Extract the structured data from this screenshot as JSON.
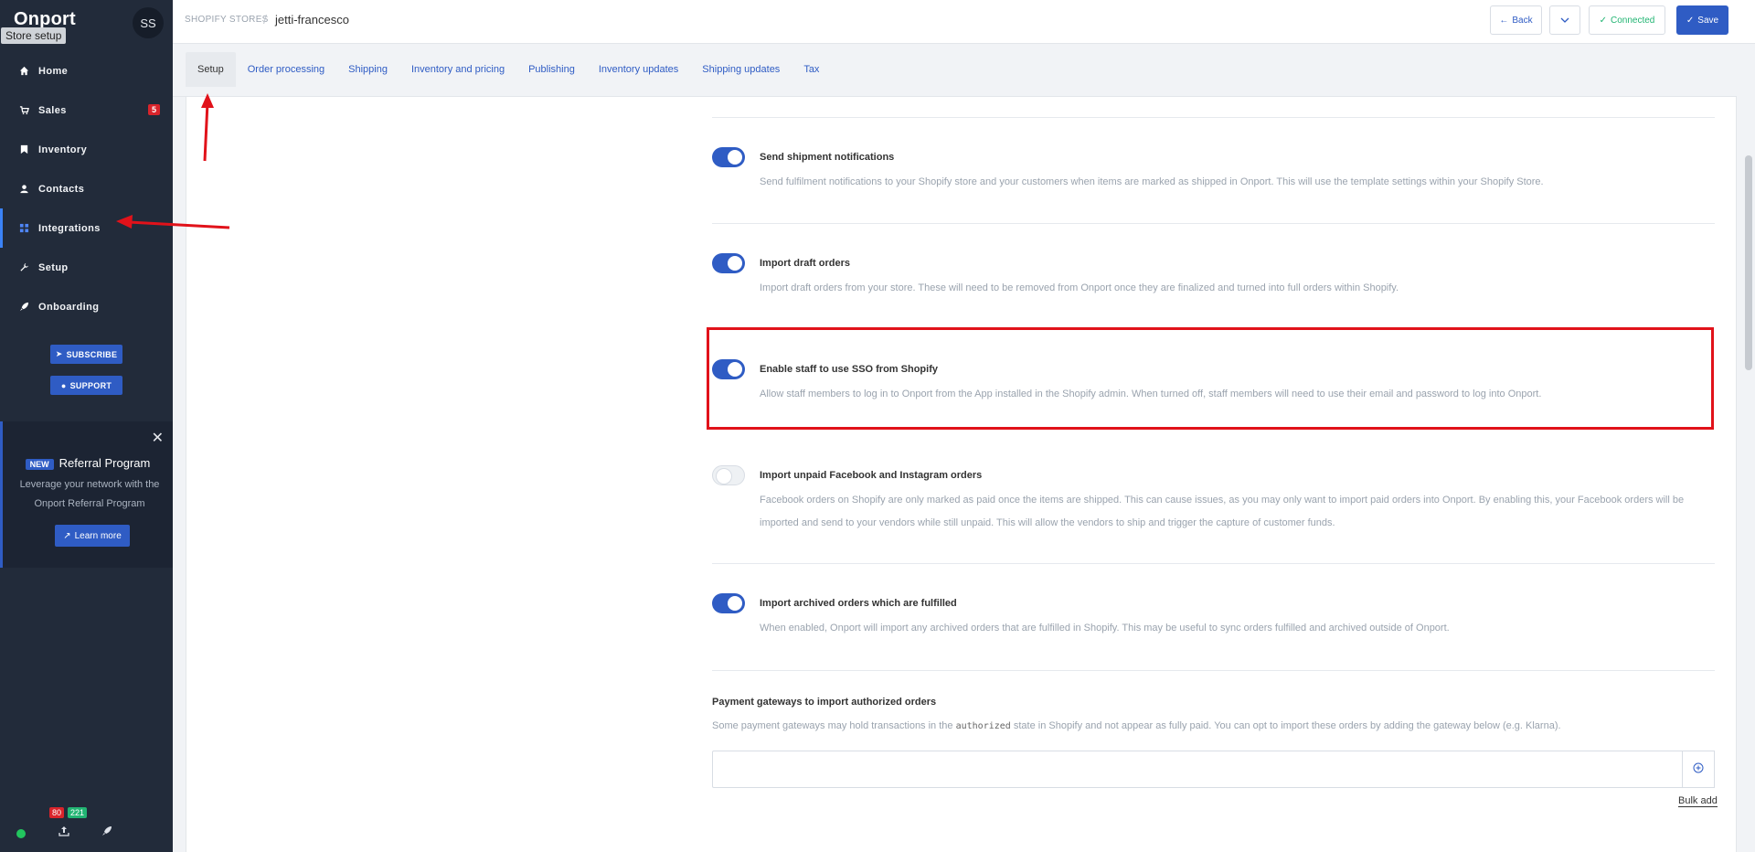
{
  "sidebar": {
    "brand": "Onport",
    "avatar": "SS",
    "tooltip": "Store setup",
    "items": [
      {
        "label": "Home",
        "icon": "home-icon"
      },
      {
        "label": "Sales",
        "icon": "cart-icon",
        "badge": "5"
      },
      {
        "label": "Inventory",
        "icon": "bookmark-icon"
      },
      {
        "label": "Contacts",
        "icon": "user-icon"
      },
      {
        "label": "Integrations",
        "icon": "grid-icon"
      },
      {
        "label": "Setup",
        "icon": "wrench-icon"
      },
      {
        "label": "Onboarding",
        "icon": "rocket-icon"
      }
    ],
    "subscribe_label": "SUBSCRIBE",
    "support_label": "SUPPORT",
    "referral": {
      "new_badge": "NEW",
      "title": "Referral Program",
      "text": "Leverage your network with the Onport Referral Program",
      "button": "Learn more"
    },
    "footer": {
      "count_red": "80",
      "count_green": "221"
    }
  },
  "header": {
    "store_crumb": "SHOPIFY STORES",
    "separator": "/",
    "store_name": "jetti-francesco",
    "back_label": "Back",
    "connected_label": "Connected",
    "save_label": "Save"
  },
  "tabs": [
    {
      "label": "Setup",
      "active": true
    },
    {
      "label": "Order processing"
    },
    {
      "label": "Shipping"
    },
    {
      "label": "Inventory and pricing"
    },
    {
      "label": "Publishing"
    },
    {
      "label": "Inventory updates"
    },
    {
      "label": "Shipping updates"
    },
    {
      "label": "Tax"
    }
  ],
  "settings": [
    {
      "title": "Send shipment notifications",
      "desc": "Send fulfilment notifications to your Shopify store and your customers when items are marked as shipped in Onport. This will use the template settings within your Shopify Store.",
      "enabled": true
    },
    {
      "title": "Import draft orders",
      "desc": "Import draft orders from your store. These will need to be removed from Onport once they are finalized and turned into full orders within Shopify.",
      "enabled": true
    },
    {
      "title": "Enable staff to use SSO from Shopify",
      "desc": "Allow staff members to log in to Onport from the App installed in the Shopify admin. When turned off, staff members will need to use their email and password to log into Onport.",
      "enabled": true
    },
    {
      "title": "Import unpaid Facebook and Instagram orders",
      "desc": "Facebook orders on Shopify are only marked as paid once the items are shipped. This can cause issues, as you may only want to import paid orders into Onport. By enabling this, your Facebook orders will be imported and send to your vendors while still unpaid. This will allow the vendors to ship and trigger the capture of customer funds.",
      "enabled": false
    },
    {
      "title": "Import archived orders which are fulfilled",
      "desc": "When enabled, Onport will import any archived orders that are fulfilled in Shopify. This may be useful to sync orders fulfilled and archived outside of Onport.",
      "enabled": true
    }
  ],
  "payment_gateways": {
    "title": "Payment gateways to import authorized orders",
    "desc_before": "Some payment gateways may hold transactions in the",
    "desc_code": "authorized",
    "desc_after": "state in Shopify and not appear as fully paid. You can opt to import these orders by adding the gateway below (e.g. Klarna).",
    "input_value": "",
    "bulk_add": "Bulk add"
  },
  "colors": {
    "accent": "#2f5cc4",
    "highlight": "#e1121a",
    "success": "#22b573",
    "danger": "#d9242b"
  }
}
